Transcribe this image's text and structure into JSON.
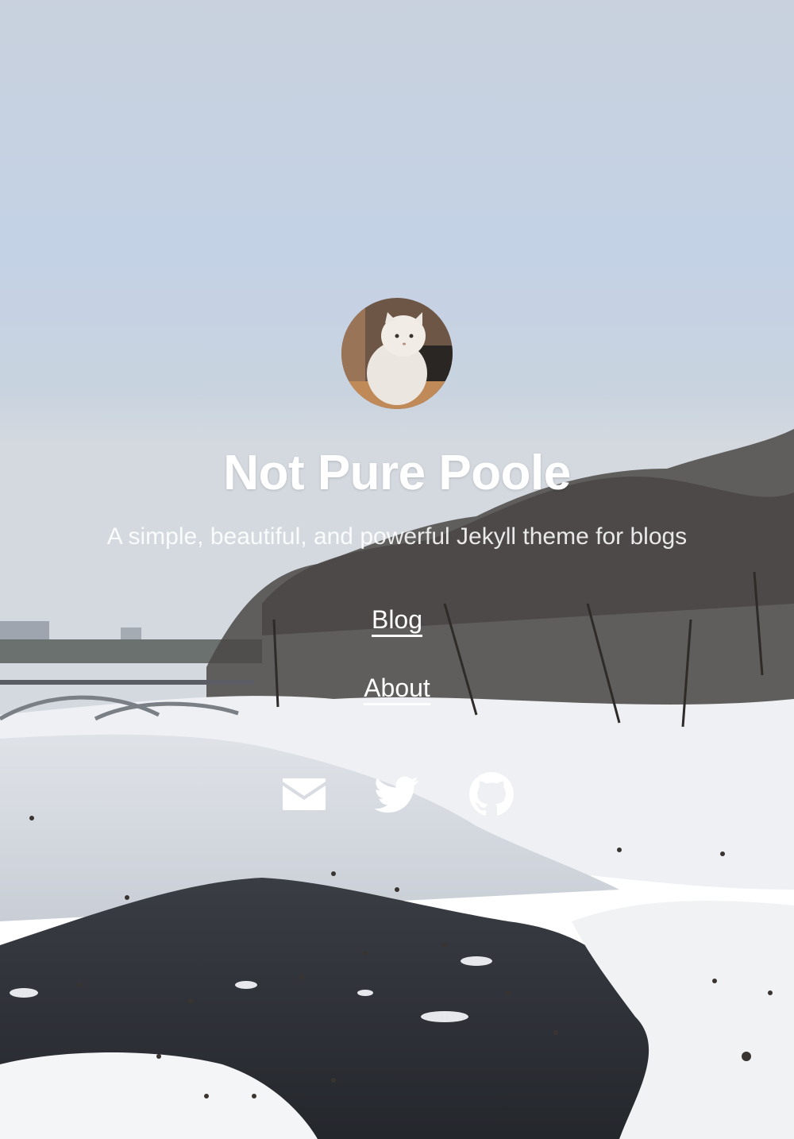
{
  "site": {
    "title": "Not Pure Poole",
    "description": "A simple, beautiful, and powerful Jekyll theme for blogs"
  },
  "nav": [
    {
      "label": "Blog"
    },
    {
      "label": "About"
    }
  ],
  "social": [
    {
      "icon": "email-icon"
    },
    {
      "icon": "twitter-icon"
    },
    {
      "icon": "github-icon"
    }
  ],
  "colors": {
    "text": "#ffffff",
    "sky": "#c9d6e6",
    "snow": "#f2f3f6",
    "water": "#2a2d33"
  }
}
